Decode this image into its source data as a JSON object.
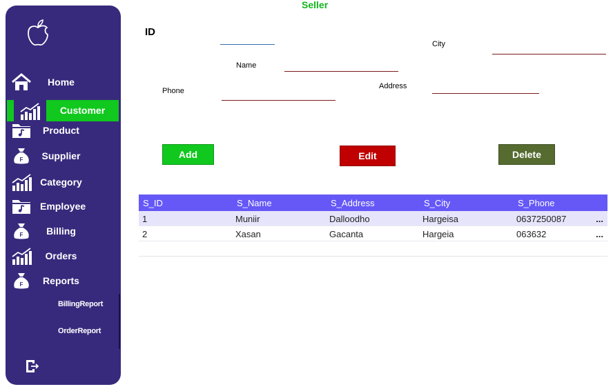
{
  "page_title": "Seller",
  "sidebar": {
    "items": [
      {
        "label": "Home",
        "icon": "home-icon"
      },
      {
        "label": "Customer",
        "icon": "chart-icon"
      },
      {
        "label": "Product",
        "icon": "folder-music-icon"
      },
      {
        "label": "Supplier",
        "icon": "money-bag-icon"
      },
      {
        "label": "Category",
        "icon": "chart-icon"
      },
      {
        "label": "Employee",
        "icon": "folder-music-icon"
      },
      {
        "label": "Billing",
        "icon": "money-bag-icon"
      },
      {
        "label": "Orders",
        "icon": "chart-icon"
      },
      {
        "label": "Reports",
        "icon": "money-bag-icon"
      }
    ],
    "sub_items": [
      "BillingReport",
      "OrderReport"
    ],
    "active": "Customer",
    "active_color": "#11C81E",
    "background": "#372A7C"
  },
  "form": {
    "id_label": "ID",
    "name_label": "Name",
    "phone_label": "Phone",
    "city_label": "City",
    "address_label": "Address",
    "id_value": "",
    "name_value": "",
    "phone_value": "",
    "city_value": "",
    "address_value": ""
  },
  "buttons": {
    "add": {
      "label": "Add",
      "color": "#11C81E"
    },
    "edit": {
      "label": "Edit",
      "color": "#C00000"
    },
    "delete": {
      "label": "Delete",
      "color": "#556B2F"
    }
  },
  "table": {
    "header_color": "#6558F7",
    "columns": [
      "S_ID",
      "S_Name",
      "S_Address",
      "S_City",
      "S_Phone"
    ],
    "rows": [
      [
        "1",
        "Muniir",
        "Dalloodho",
        "Hargeisa",
        "0637250087"
      ],
      [
        "2",
        "Xasan",
        "Gacanta",
        "Hargeia",
        "063632"
      ]
    ],
    "overflow": "..."
  }
}
